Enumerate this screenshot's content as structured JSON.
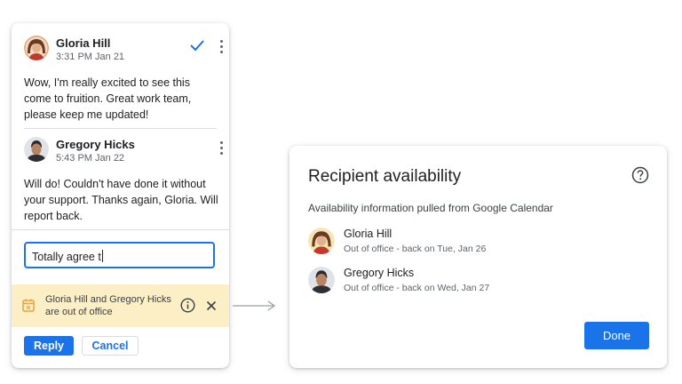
{
  "comments": [
    {
      "author": "Gloria Hill",
      "timestamp": "3:31 PM Jan 21",
      "lines": [
        "Wow, I'm really excited to see this",
        "come to fruition. Great work team,",
        "please keep me updated!"
      ],
      "resolved_icon": "check-icon",
      "more_icon": "more-vert-icon"
    },
    {
      "author": "Gregory Hicks",
      "timestamp": "5:43 PM Jan 22",
      "lines": [
        "Will do! Couldn't have done it without",
        "your support. Thanks again, Gloria. Will",
        "report back."
      ],
      "more_icon": "more-vert-icon"
    }
  ],
  "reply_input": {
    "value": "Totally agree t"
  },
  "ooo_banner": {
    "message": "Gloria Hill and Gregory Hicks are out of office",
    "icon": "calendar-icon",
    "info_icon": "info-icon",
    "close_icon": "close-icon",
    "background": "#fdefc5"
  },
  "actions": {
    "reply_label": "Reply",
    "cancel_label": "Cancel"
  },
  "availability": {
    "title": "Recipient availability",
    "subtitle": "Availability information pulled from Google Calendar",
    "help_icon": "help-icon",
    "recipients": [
      {
        "name": "Gloria Hill",
        "status": "Out of office - back on Tue, Jan 26"
      },
      {
        "name": "Gregory Hicks",
        "status": "Out of office - back on Wed, Jan 27"
      }
    ],
    "done_label": "Done"
  },
  "colors": {
    "accent": "#1a73e8",
    "text": "#202124",
    "muted": "#5f6368"
  }
}
